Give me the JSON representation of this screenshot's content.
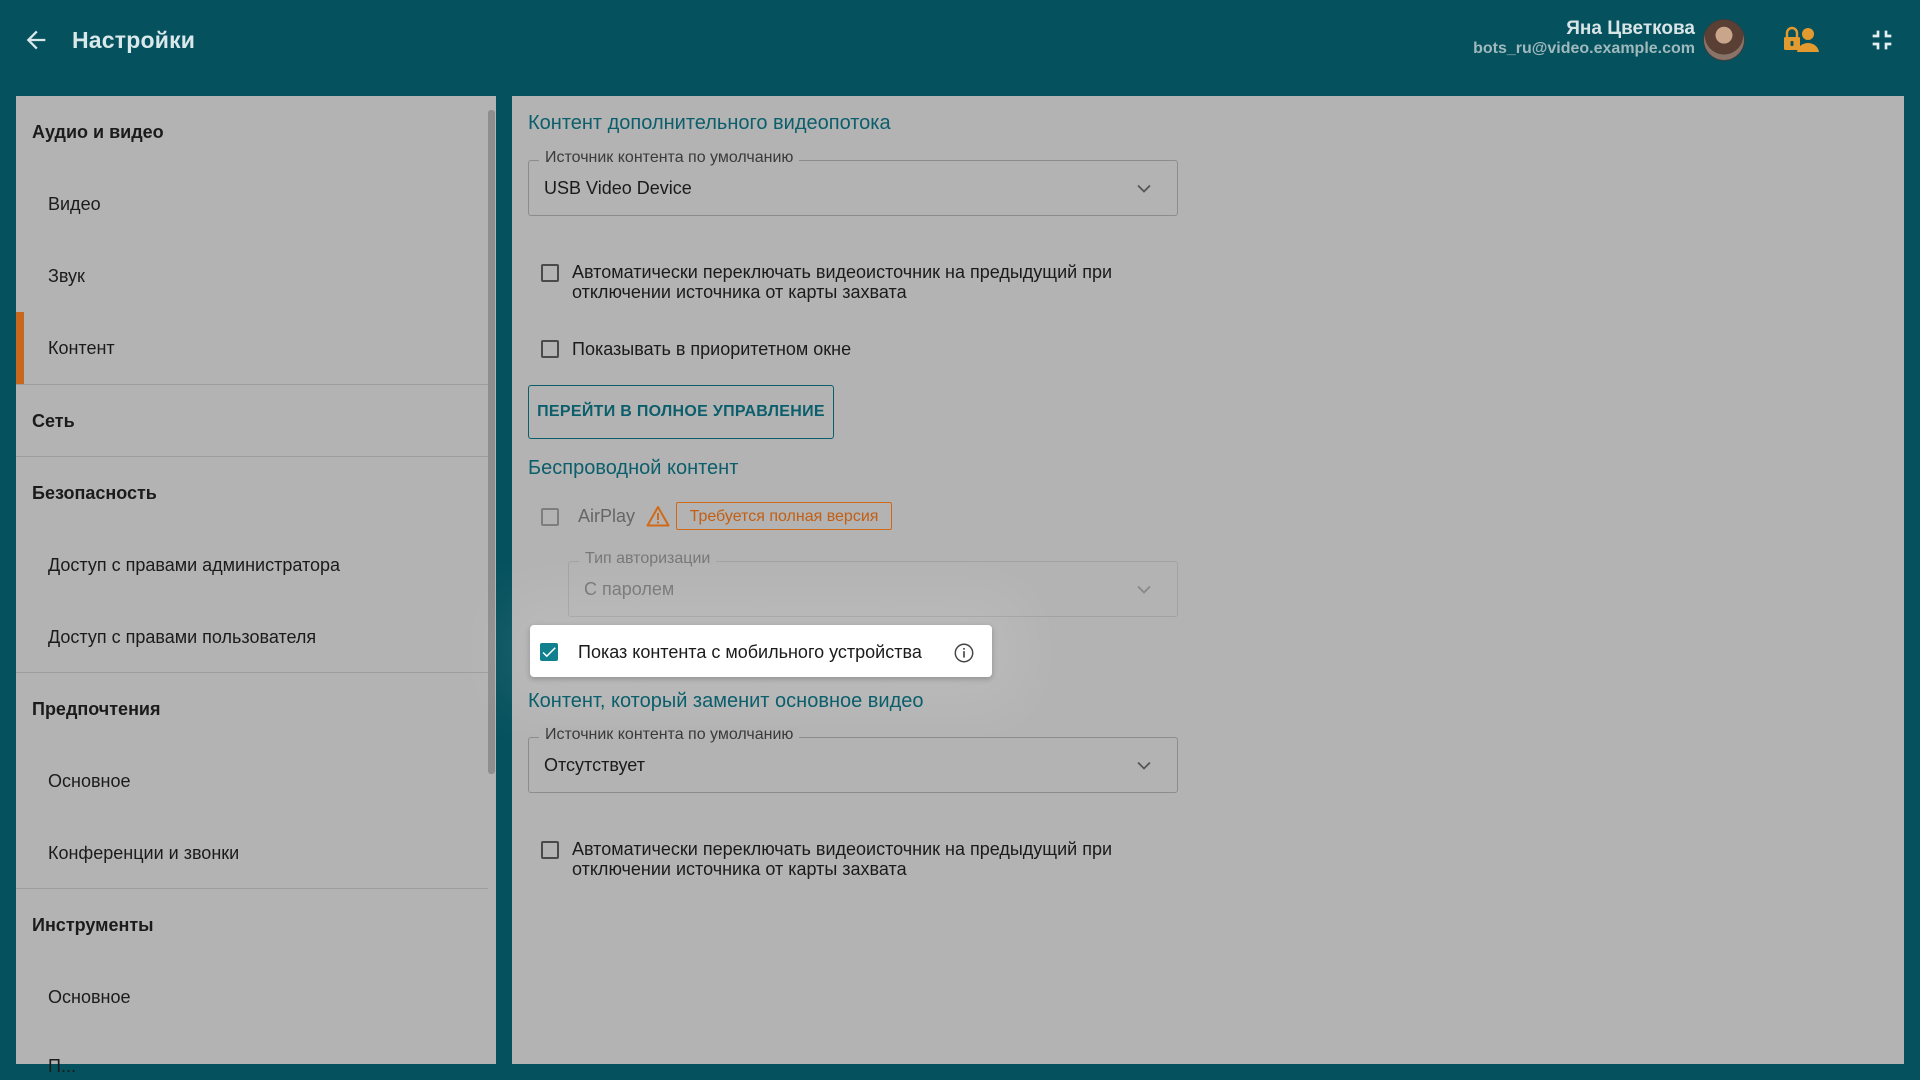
{
  "header": {
    "title": "Настройки",
    "user_name": "Яна Цветкова",
    "user_email": "bots_ru@video.example.com",
    "icons": {
      "back": "arrow-left-icon",
      "lock_user": "lock-user-icon",
      "collapse": "collapse-icon"
    }
  },
  "sidebar": {
    "groups": [
      {
        "heading": "Аудио и видео",
        "items": [
          "Видео",
          "Звук",
          "Контент"
        ]
      },
      {
        "heading": "Сеть",
        "items": []
      },
      {
        "heading": "Безопасность",
        "items": [
          "Доступ с правами администратора",
          "Доступ с правами пользователя"
        ]
      },
      {
        "heading": "Предпочтения",
        "items": [
          "Основное",
          "Конференции и звонки"
        ]
      },
      {
        "heading": "Инструменты",
        "items": [
          "Основное",
          "П..."
        ]
      }
    ],
    "active_item": "Контент"
  },
  "main": {
    "secondary_stream": {
      "title": "Контент дополнительного видеопотока",
      "source_label": "Источник контента по умолчанию",
      "source_value": "USB Video Device",
      "auto_switch_label": "Автоматически переключать видеоисточник на предыдущий при отключении источника от карты захвата",
      "auto_switch_checked": false,
      "priority_window_label": "Показывать в приоритетном окне",
      "priority_window_checked": false,
      "full_control_button": "ПЕРЕЙТИ В ПОЛНОЕ УПРАВЛЕНИЕ"
    },
    "wireless": {
      "title": "Беспроводной контент",
      "airplay_label": "AirPlay",
      "airplay_checked": false,
      "full_version_badge": "Требуется полная версия",
      "auth_type_label": "Тип авторизации",
      "auth_type_value": "С паролем",
      "mobile_content_label": "Показ контента с мобильного устройства",
      "mobile_content_checked": true
    },
    "replace_main": {
      "title": "Контент, который заменит основное видео",
      "source_label": "Источник контента по умолчанию",
      "source_value": "Отсутствует",
      "auto_switch_label": "Автоматически переключать видеоисточник на предыдущий при отключении источника от карты захвата",
      "auto_switch_checked": false
    }
  },
  "colors": {
    "header_bg": "#05515d",
    "panel_bg": "#b3b3b3",
    "accent_teal": "#0b5e6b",
    "active_marker": "#c7681e",
    "warning": "#d06a18",
    "checkbox_checked": "#10808f"
  }
}
